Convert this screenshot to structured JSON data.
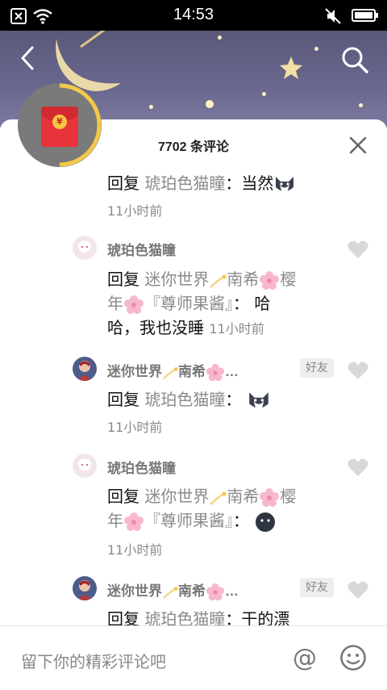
{
  "status_bar": {
    "time": "14:53"
  },
  "sheet": {
    "title": "7702 条评论"
  },
  "comments": [
    {
      "reply_word": "回复",
      "reply_to": "琥珀色猫瞳",
      "sep": "：",
      "text": "当然",
      "time": "11小时前"
    },
    {
      "user": "琥珀色猫瞳",
      "reply_word": "回复",
      "reply_to_a": "迷你世界",
      "reply_to_b": "南希",
      "reply_to_c": "樱",
      "reply_to_d": "年",
      "reply_to_e": "『尊师果酱』",
      "sep": "：",
      "text_a": "哈",
      "text_b": "哈，我也没睡",
      "time": "11小时前"
    },
    {
      "user_a": "迷你世界",
      "user_b": "南希",
      "user_ellipsis": "…",
      "badge": "好友",
      "reply_word": "回复",
      "reply_to": "琥珀色猫瞳",
      "sep": "：",
      "time": "11小时前"
    },
    {
      "user": "琥珀色猫瞳",
      "reply_word": "回复",
      "reply_to_a": "迷你世界",
      "reply_to_b": "南希",
      "reply_to_c": "樱",
      "reply_to_d": "年",
      "reply_to_e": "『尊师果酱』",
      "sep": "：",
      "time": "11小时前"
    },
    {
      "user_a": "迷你世界",
      "user_b": "南希",
      "user_ellipsis": "…",
      "badge": "好友",
      "reply_word": "回复",
      "reply_to": "琥珀色猫瞳",
      "sep": "：",
      "text": "干的漂"
    }
  ],
  "input": {
    "placeholder": "留下你的精彩评论吧",
    "at_symbol": "@"
  },
  "colors": {
    "accent_ring": "#f3c94a",
    "envelope": "#e8333a",
    "muted_text": "#8a8a8a"
  }
}
